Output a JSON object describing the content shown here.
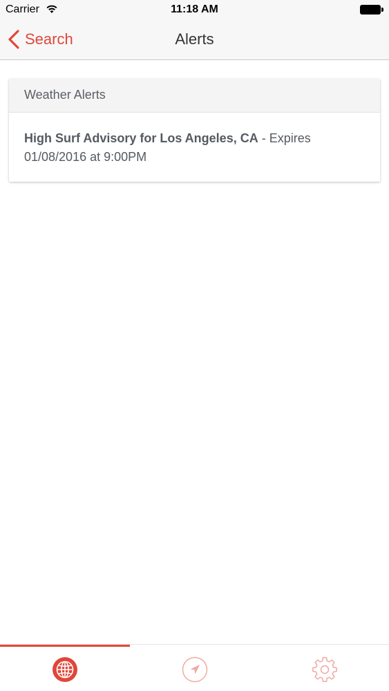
{
  "status_bar": {
    "carrier": "Carrier",
    "time": "11:18 AM"
  },
  "nav": {
    "back_label": "Search",
    "title": "Alerts"
  },
  "card": {
    "header": "Weather Alerts",
    "alert": {
      "title": "High Surf Advisory for Los Angeles, CA",
      "expires": " - Expires 01/08/2016 at 9:00PM"
    }
  },
  "tabs": [
    {
      "icon": "globe-icon",
      "active": true
    },
    {
      "icon": "location-arrow-icon",
      "active": false
    },
    {
      "icon": "gear-icon",
      "active": false
    }
  ],
  "colors": {
    "accent": "#e0473a",
    "accent_muted": "#f1a8a1",
    "text": "#555a61"
  }
}
